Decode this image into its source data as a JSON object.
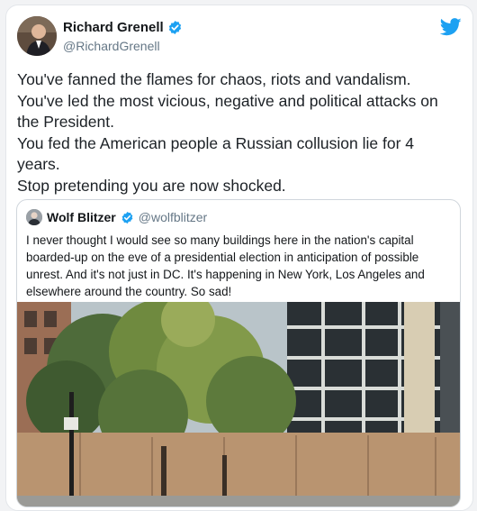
{
  "tweet": {
    "author": {
      "name": "Richard Grenell",
      "handle": "@RichardGrenell"
    },
    "text_lines": [
      "You've fanned the flames for chaos, riots and vandalism.",
      "You've led the most vicious, negative and political attacks on",
      "the President.",
      "You fed the American people a Russian collusion lie for 4",
      "years.",
      "Stop pretending you are now shocked."
    ]
  },
  "quoted_tweet": {
    "author": {
      "name": "Wolf Blitzer",
      "handle": "@wolfblitzer"
    },
    "text_lines": [
      "I never thought I would see so many buildings here in the nation's capital",
      "boarded-up on the eve of a presidential election in anticipation of possible",
      "unrest. And it's not just in DC. It's happening in New York, Los Angeles and",
      "elsewhere around the country. So sad!"
    ]
  },
  "icons": {
    "verified": "verified-badge-icon",
    "brand": "twitter-bird-icon"
  },
  "colors": {
    "brand_blue": "#1da1f2",
    "text_primary": "#14171a",
    "text_secondary": "#657786"
  }
}
